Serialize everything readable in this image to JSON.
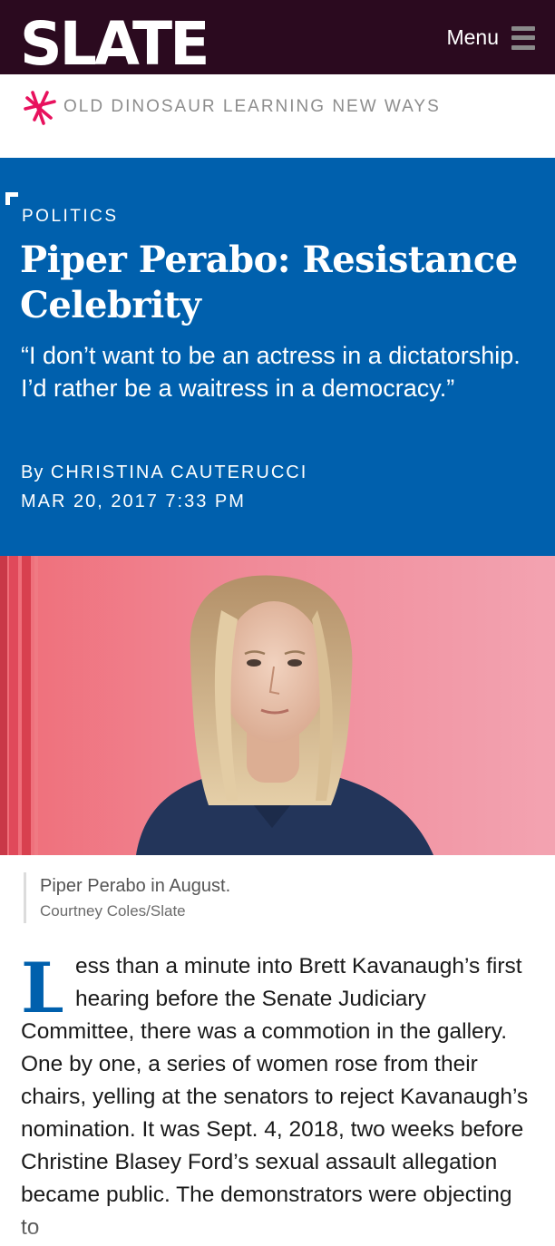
{
  "site": {
    "logo": "SLATE",
    "menu_label": "Menu"
  },
  "promo": {
    "icon": "starburst-icon",
    "text": "OLD DINOSAUR LEARNING NEW WAYS"
  },
  "article": {
    "section": "POLITICS",
    "headline": "Piper Perabo: Resistance Celebrity",
    "dek": "“I don’t want to be an actress in a dictatorship. I’d rather be a waitress in a democracy.”",
    "byline_prefix": "By",
    "author": "CHRISTINA CAUTERUCCI",
    "date": "MAR 20, 2017 7:33 PM",
    "image_caption": "Piper Perabo in August.",
    "image_credit": "Courtney Coles/Slate",
    "drop_cap": "L",
    "body_text": "ess than a minute into Brett Kavanaugh’s first hearing before the Senate Judiciary Committee, there was a commotion in the gallery. One by one, a series of women rose from their chairs, yelling at the senators to reject Kavanaugh’s nomination. It was Sept. 4, 2018, two weeks before Christine Blasey Ford’s sexual assault allegation became public. The demonstrators were objecting to"
  },
  "colors": {
    "topbar": "#2b0a1f",
    "hero": "#0060ad",
    "accent_pink": "#e8115d"
  }
}
